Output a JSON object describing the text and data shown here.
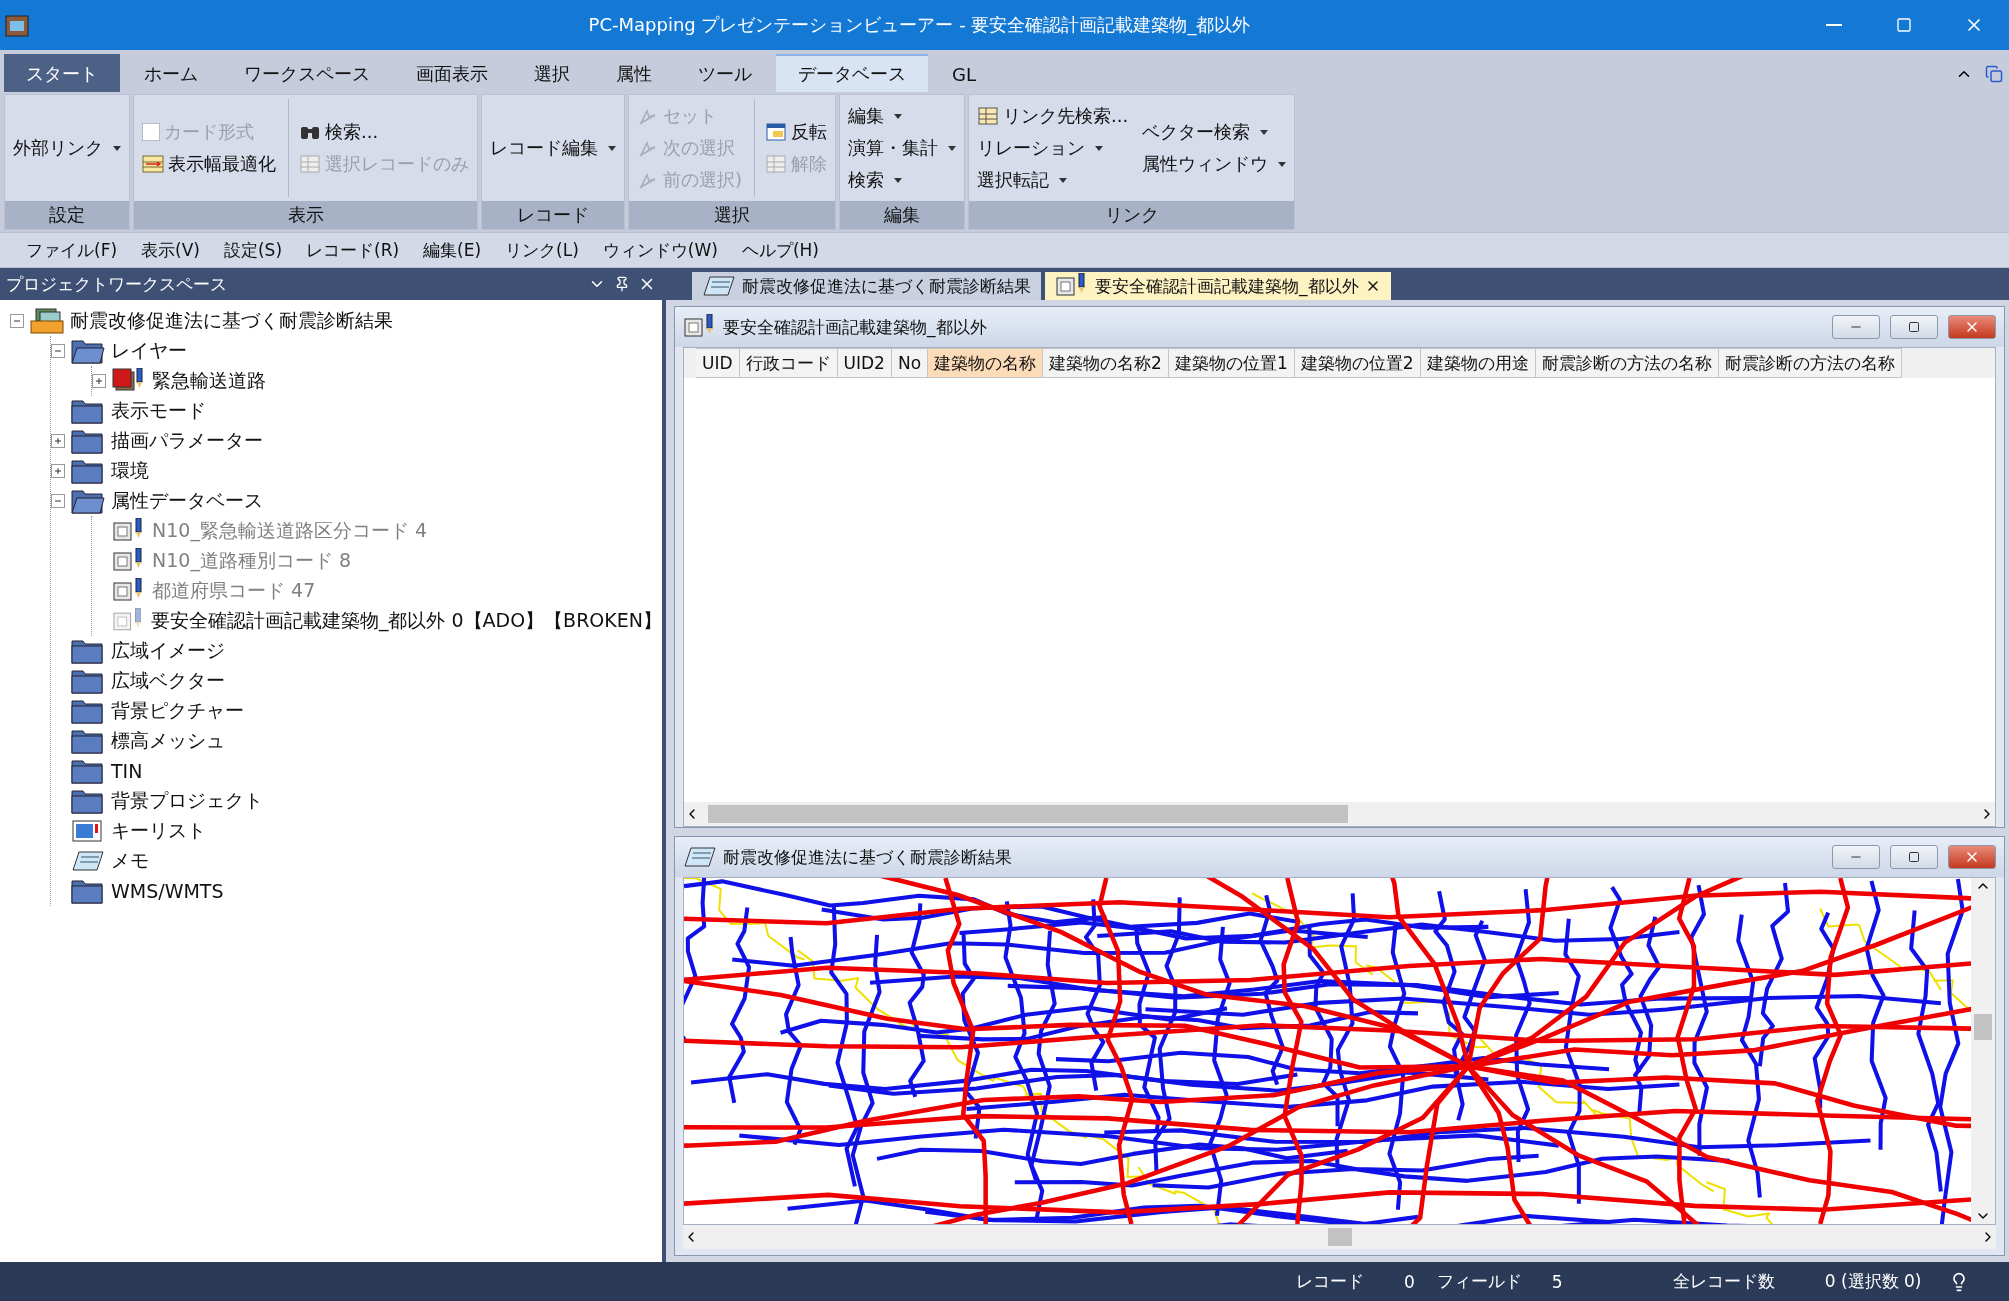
{
  "window": {
    "title": "PC-Mapping プレゼンテーションビューアー - 要安全確認計画記載建築物_都以外"
  },
  "ribbon_tabs": [
    {
      "label": "スタート",
      "kind": "app",
      "selected": false
    },
    {
      "label": "ホーム",
      "kind": "tab",
      "selected": false
    },
    {
      "label": "ワークスペース",
      "kind": "tab",
      "selected": false
    },
    {
      "label": "画面表示",
      "kind": "tab",
      "selected": false
    },
    {
      "label": "選択",
      "kind": "tab",
      "selected": false
    },
    {
      "label": "属性",
      "kind": "tab",
      "selected": false
    },
    {
      "label": "ツール",
      "kind": "tab",
      "selected": false
    },
    {
      "label": "データベース",
      "kind": "tab",
      "selected": true
    },
    {
      "label": "GL",
      "kind": "tab",
      "selected": false
    }
  ],
  "ribbon_groups": [
    {
      "label": "設定",
      "columns": [
        [
          {
            "kind": "plain",
            "label": "外部リンク",
            "dropdown": true,
            "disabled": false
          }
        ]
      ]
    },
    {
      "label": "表示",
      "columns": [
        [
          {
            "kind": "checkbox",
            "label": "カード形式",
            "checked": false,
            "disabled": true
          },
          {
            "kind": "table",
            "label": "表示幅最適化",
            "dropdown": false,
            "disabled": false
          }
        ],
        [
          {
            "kind": "binoculars",
            "label": "検索...",
            "dropdown": false,
            "disabled": false
          },
          {
            "kind": "grid",
            "label": "選択レコードのみ",
            "dropdown": false,
            "disabled": true
          }
        ]
      ]
    },
    {
      "label": "レコード",
      "columns": [
        [
          {
            "kind": "plain",
            "label": "レコード編集",
            "dropdown": true,
            "disabled": false
          }
        ]
      ]
    },
    {
      "label": "選択",
      "columns": [
        [
          {
            "kind": "cursor",
            "label": "セット",
            "dropdown": false,
            "disabled": true
          },
          {
            "kind": "cursor",
            "label": "次の選択",
            "dropdown": false,
            "disabled": true
          },
          {
            "kind": "cursor",
            "label": "前の選択)",
            "dropdown": false,
            "disabled": true
          }
        ],
        [
          {
            "kind": "window",
            "label": "反転",
            "dropdown": false,
            "disabled": false
          },
          {
            "kind": "grid",
            "label": "解除",
            "dropdown": false,
            "disabled": true
          }
        ]
      ]
    },
    {
      "label": "編集",
      "columns": [
        [
          {
            "kind": "plain",
            "label": "編集",
            "dropdown": true,
            "disabled": false
          },
          {
            "kind": "plain",
            "label": "演算・集計",
            "dropdown": true,
            "disabled": false
          },
          {
            "kind": "plain",
            "label": "検索",
            "dropdown": true,
            "disabled": false
          }
        ]
      ]
    },
    {
      "label": "リンク",
      "columns": [
        [
          {
            "kind": "grid",
            "label": "リンク先検索...",
            "dropdown": false,
            "disabled": false
          },
          {
            "kind": "plain",
            "label": "リレーション",
            "dropdown": true,
            "disabled": false
          },
          {
            "kind": "plain",
            "label": "選択転記",
            "dropdown": true,
            "disabled": false
          }
        ],
        [
          {
            "kind": "plain",
            "label": "ベクター検索",
            "dropdown": true,
            "disabled": false
          },
          {
            "kind": "plain",
            "label": "属性ウィンドウ",
            "dropdown": true,
            "disabled": false
          }
        ]
      ]
    }
  ],
  "menu": [
    "ファイル(F)",
    "表示(V)",
    "設定(S)",
    "レコード(R)",
    "編集(E)",
    "リンク(L)",
    "ウィンドウ(W)",
    "ヘルプ(H)"
  ],
  "workspace": {
    "title": "プロジェクトワークスペース",
    "tree": [
      {
        "label": "耐震改修促進法に基づく耐震診断結果",
        "kind": "project",
        "expanded": true,
        "dimmed": false,
        "children": [
          {
            "label": "レイヤー",
            "kind": "folder",
            "expanded": true,
            "dimmed": false,
            "children": [
              {
                "label": "緊急輸送道路",
                "kind": "layer",
                "expanded": false,
                "dimmed": false
              }
            ]
          },
          {
            "label": "表示モード",
            "kind": "folder",
            "dimmed": false
          },
          {
            "label": "描画パラメーター",
            "kind": "folder",
            "expanded": false,
            "dimmed": false
          },
          {
            "label": "環境",
            "kind": "folder",
            "expanded": false,
            "dimmed": false
          },
          {
            "label": "属性データベース",
            "kind": "folder",
            "expanded": true,
            "dimmed": false,
            "children": [
              {
                "label": "N10_緊急輸送道路区分コード 4",
                "kind": "table",
                "dimmed": true
              },
              {
                "label": "N10_道路種別コード 8",
                "kind": "table",
                "dimmed": true
              },
              {
                "label": "都道府県コード 47",
                "kind": "table",
                "dimmed": true
              },
              {
                "label": "要安全確認計画記載建築物_都以外  0【ADO】【BROKEN】",
                "kind": "broken",
                "dimmed": false
              }
            ]
          },
          {
            "label": "広域イメージ",
            "kind": "folder",
            "dimmed": false
          },
          {
            "label": "広域ベクター",
            "kind": "folder",
            "dimmed": false
          },
          {
            "label": "背景ピクチャー",
            "kind": "folder",
            "dimmed": false
          },
          {
            "label": "標高メッシュ",
            "kind": "folder",
            "dimmed": false
          },
          {
            "label": "TIN",
            "kind": "folder",
            "dimmed": false
          },
          {
            "label": "背景プロジェクト",
            "kind": "folder",
            "dimmed": false
          },
          {
            "label": "キーリスト",
            "kind": "keylist",
            "dimmed": false
          },
          {
            "label": "メモ",
            "kind": "memo",
            "dimmed": false
          },
          {
            "label": "WMS/WMTS",
            "kind": "folder",
            "dimmed": false
          }
        ]
      }
    ]
  },
  "doc_tabs": [
    {
      "label": "耐震改修促進法に基づく耐震診断結果",
      "selected": false
    },
    {
      "label": "要安全確認計画記載建築物_都以外",
      "selected": true
    }
  ],
  "table_window": {
    "title": "要安全確認計画記載建築物_都以外",
    "columns": [
      {
        "label": "UID",
        "selected": false
      },
      {
        "label": "行政コード",
        "selected": false
      },
      {
        "label": "UID2",
        "selected": false
      },
      {
        "label": "No",
        "selected": false
      },
      {
        "label": "建築物の名称",
        "selected": true
      },
      {
        "label": "建築物の名称2",
        "selected": false
      },
      {
        "label": "建築物の位置1",
        "selected": false
      },
      {
        "label": "建築物の位置2",
        "selected": false
      },
      {
        "label": "建築物の用途",
        "selected": false
      },
      {
        "label": "耐震診断の方法の名称",
        "selected": false
      },
      {
        "label": "耐震診断の方法の名称",
        "selected": false
      }
    ]
  },
  "map_window": {
    "title": "耐震改修促進法に基づく耐震診断結果"
  },
  "status_bar": [
    "レコード",
    "0",
    "フィールド",
    "5",
    "全レコード数",
    "0 (選択数  0)"
  ]
}
